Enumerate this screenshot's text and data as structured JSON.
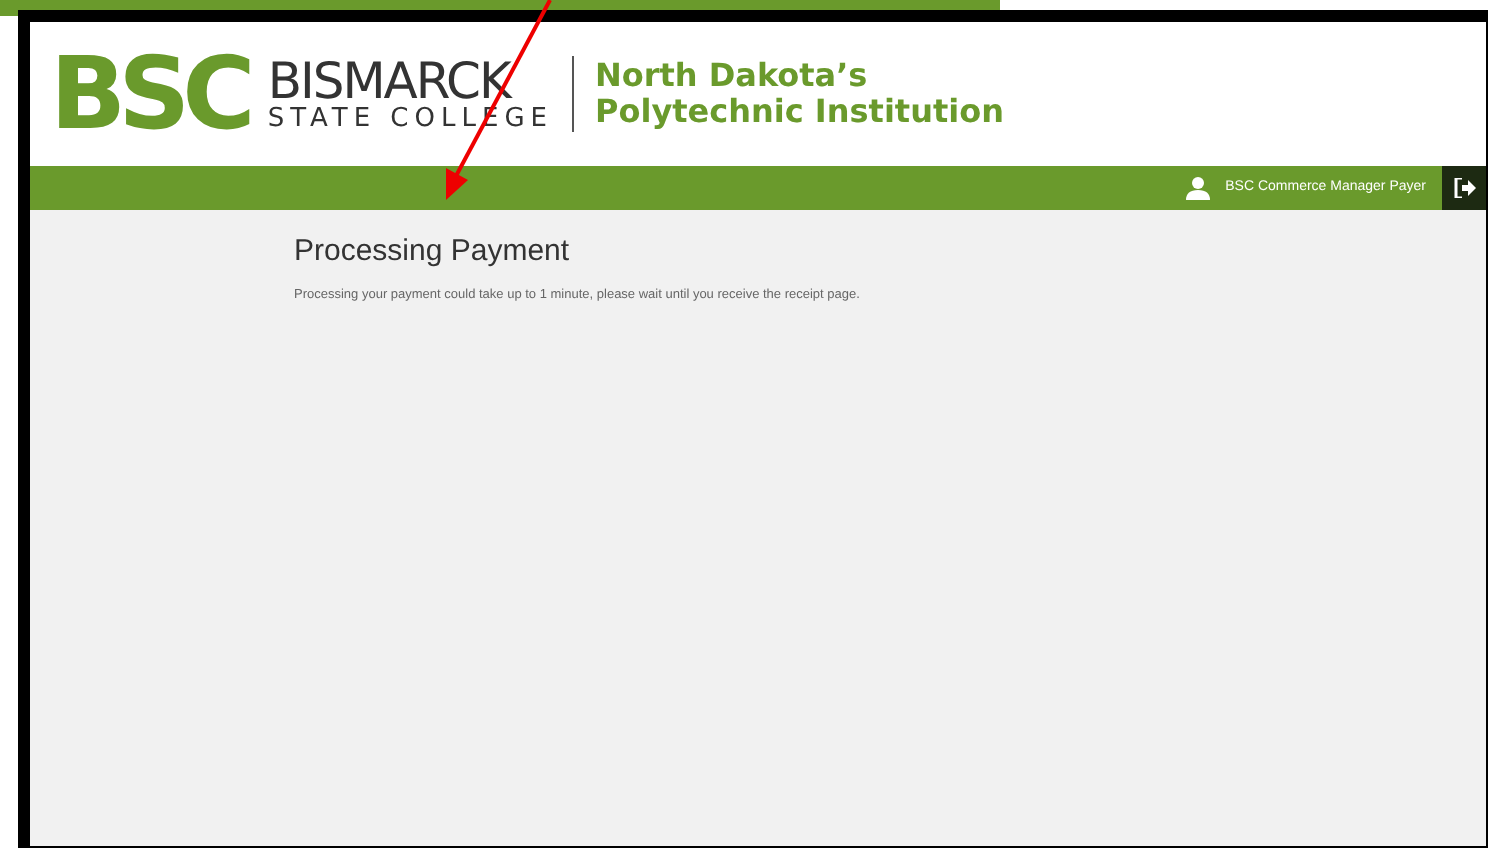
{
  "header": {
    "logo_mark": "BSC",
    "college_name": "BISMARCK",
    "college_subtitle": "STATE COLLEGE",
    "tagline_1": "North Dakota’s",
    "tagline_2": "Polytechnic Institution"
  },
  "navbar": {
    "user": "BSC Commerce Manager Payer"
  },
  "content": {
    "title": "Processing Payment",
    "message": "Processing your payment could take up to 1 minute, please wait until you receive the receipt page."
  }
}
